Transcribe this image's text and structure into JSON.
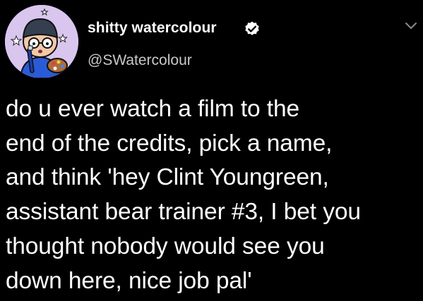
{
  "tweet": {
    "author": {
      "display_name": "shitty watercolour",
      "handle": "@SWatercolour",
      "verified": true,
      "avatar_icon": "watercolour-painter-avatar-icon",
      "verified_icon": "verified-badge-icon"
    },
    "menu_icon": "chevron-down-icon",
    "text_lines": [
      "do u ever watch a film to the",
      "end of the credits, pick a name,",
      "and think 'hey Clint Youngreen,",
      "assistant bear trainer #3, I bet you",
      "thought nobody would see you",
      "down here, nice job pal'"
    ]
  },
  "colors": {
    "background": "#000000",
    "text": "#ffffff",
    "handle": "#c8c8c8",
    "avatar_bg": "#d9c6ef",
    "chevron": "#8a8a8a"
  }
}
